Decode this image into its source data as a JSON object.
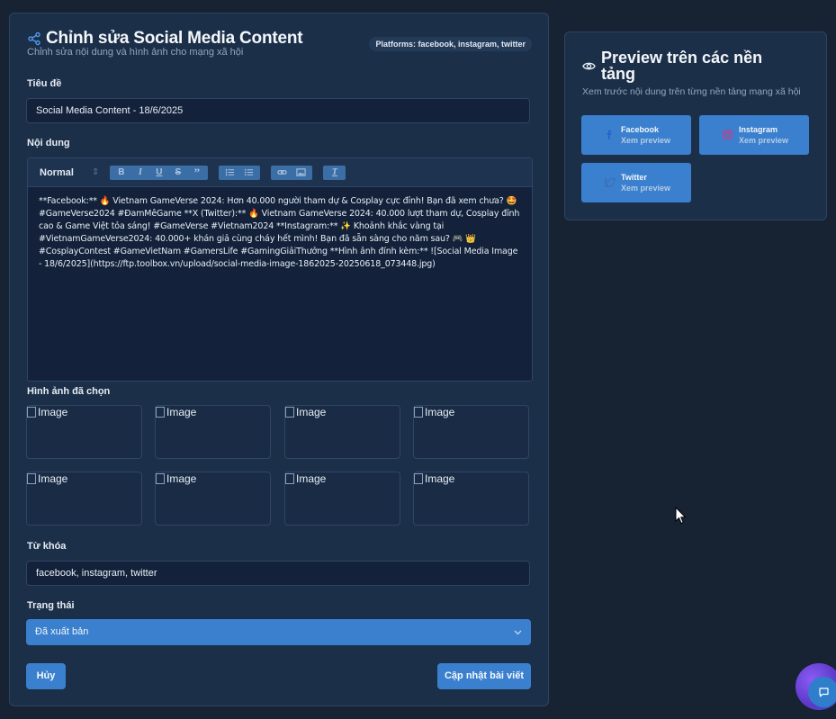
{
  "editor": {
    "title": "Chỉnh sửa Social Media Content",
    "subtitle": "Chỉnh sửa nội dung và hình ảnh cho mạng xã hội",
    "platforms_badge": "Platforms: facebook, instagram, twitter",
    "title_field": {
      "label": "Tiêu đề",
      "value": "Social Media Content - 18/6/2025"
    },
    "content_field": {
      "label": "Nội dung",
      "toolbar_format": "Normal",
      "body": "**Facebook:** 🔥 Vietnam GameVerse 2024: Hơn 40.000 người tham dự & Cosplay cực đỉnh! Bạn đã xem chưa? 🤩 #GameVerse2024 #ĐamMêGame **X (Twitter):** 🔥 Vietnam GameVerse 2024: 40.000 lượt tham dự, Cosplay đỉnh cao & Game Việt tỏa sáng! #GameVerse #Vietnam2024 **Instagram:** ✨ Khoảnh khắc vàng tại #VietnamGameVerse2024: 40.000+ khán giả cùng cháy hết mình! Bạn đã sẵn sàng cho năm sau? 🎮 👑 #CosplayContest #GameVietNam #GamersLife #GamingGiảiThưởng **Hình ảnh đính kèm:** ![Social Media Image - 18/6/2025](https://ftp.toolbox.vn/upload/social-media-image-1862025-20250618_073448.jpg)"
    },
    "images": {
      "label": "Hình ảnh đã chọn",
      "alts": [
        "Image",
        "Image",
        "Image",
        "Image",
        "Image",
        "Image",
        "Image",
        "Image"
      ]
    },
    "keywords": {
      "label": "Từ khóa",
      "value": "facebook, instagram, twitter"
    },
    "status": {
      "label": "Trạng thái",
      "selected": "Đã xuất bản"
    },
    "cancel_label": "Hủy",
    "submit_label": "Cập nhật bài viết"
  },
  "preview": {
    "title": "Preview trên các nền tảng",
    "subtitle": "Xem trước nội dung trên từng nền tảng mạng xã hội",
    "platforms": [
      {
        "name": "Facebook",
        "hint": "Xem preview",
        "icon": "facebook-icon"
      },
      {
        "name": "Instagram",
        "hint": "Xem preview",
        "icon": "instagram-icon"
      },
      {
        "name": "Twitter",
        "hint": "Xem preview",
        "icon": "twitter-icon"
      }
    ]
  },
  "colors": {
    "page_bg": "#172233",
    "card_bg": "#1c2f48",
    "accent": "#3a80cf"
  }
}
